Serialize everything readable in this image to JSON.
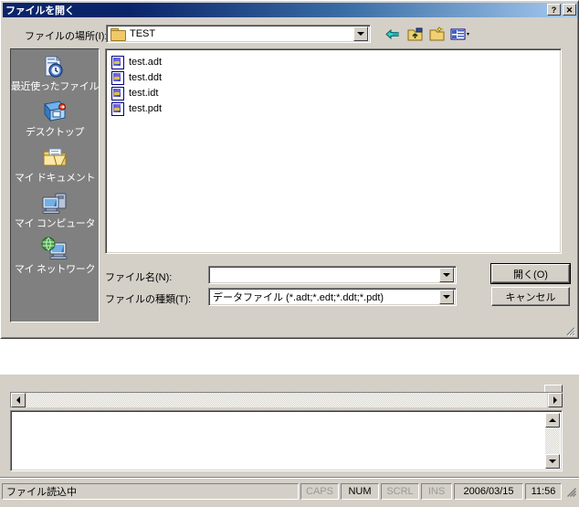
{
  "dialog": {
    "title": "ファイルを開く",
    "titlebar_buttons": [
      {
        "name": "help-button",
        "label": "?"
      },
      {
        "name": "close-button",
        "label": "✕"
      }
    ],
    "lookin": {
      "label": "ファイルの場所(I):",
      "value": "TEST",
      "icon": "folder-icon"
    },
    "toolbar": [
      {
        "name": "back-icon",
        "title": "前に戻る"
      },
      {
        "name": "up-one-level-icon",
        "title": "一つ上へ"
      },
      {
        "name": "new-folder-icon",
        "title": "新しいフォルダの作成"
      },
      {
        "name": "views-icon",
        "title": "表示"
      }
    ],
    "places": [
      {
        "name": "recent-documents",
        "label": "最近使ったファイル",
        "icon": "recent-icon"
      },
      {
        "name": "desktop",
        "label": "デスクトップ",
        "icon": "desktop-icon"
      },
      {
        "name": "my-documents",
        "label": "マイ ドキュメント",
        "icon": "documents-icon"
      },
      {
        "name": "my-computer",
        "label": "マイ コンピュータ",
        "icon": "computer-icon"
      },
      {
        "name": "my-network",
        "label": "マイ ネットワーク",
        "icon": "network-icon"
      }
    ],
    "files": [
      {
        "name": "test.adt",
        "icon": "data-file-icon"
      },
      {
        "name": "test.ddt",
        "icon": "data-file-icon"
      },
      {
        "name": "test.idt",
        "icon": "data-file-icon"
      },
      {
        "name": "test.pdt",
        "icon": "data-file-icon"
      }
    ],
    "filename_field": {
      "label": "ファイル名(N):",
      "value": ""
    },
    "filetype_field": {
      "label": "ファイルの種類(T):",
      "value": "データファイル (*.adt;*.edt;*.ddt;*.pdt)"
    },
    "buttons": {
      "open": "開く(O)",
      "cancel": "キャンセル"
    }
  },
  "background_window": {
    "text_panel_value": "",
    "scroll": {
      "left_arrow": "◀",
      "right_arrow": "▶",
      "up_arrow": "▲",
      "down_arrow": "▼"
    }
  },
  "statusbar": {
    "message": "ファイル読込中",
    "indicators": [
      {
        "label": "CAPS",
        "active": false
      },
      {
        "label": "NUM",
        "active": true
      },
      {
        "label": "SCRL",
        "active": false
      },
      {
        "label": "INS",
        "active": false
      }
    ],
    "date": "2006/03/15",
    "time": "11:56"
  },
  "colors": {
    "dialog_face": "#d4d0c8",
    "titlebar_start": "#0a246a",
    "titlebar_end": "#a6caf0",
    "places_bar": "#808080",
    "text_disabled": "#9a9a94"
  }
}
